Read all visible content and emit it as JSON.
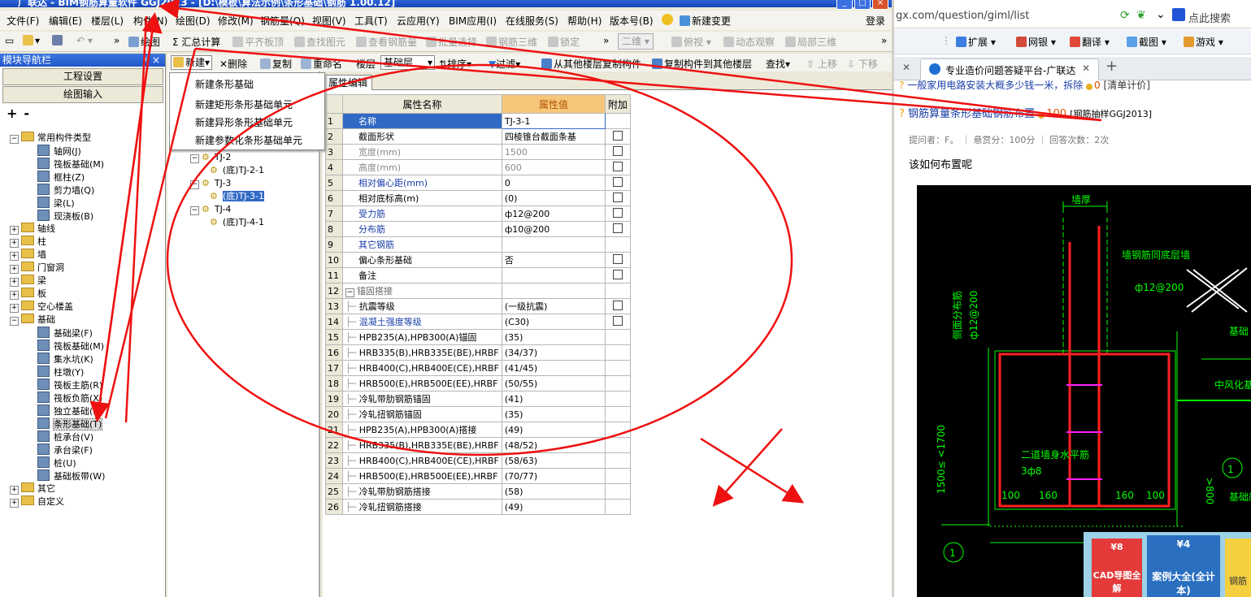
{
  "titlebar": {
    "title": "广联达 - BIM钢筋算量软件 GGJ2013 - [D:\\模板\\算法示例\\条形基础\\钢筋 1.00.12]"
  },
  "menu": [
    "文件(F)",
    "编辑(E)",
    "楼层(L)",
    "构件(N)",
    "绘图(D)",
    "修改(M)",
    "钢筋量(Q)",
    "视图(V)",
    "工具(T)",
    "云应用(Y)",
    "BIM应用(I)",
    "在线服务(S)",
    "帮助(H)",
    "版本号(B)"
  ],
  "menu_extra": {
    "new_change": "新建变更",
    "login": "登录"
  },
  "toolbar1": {
    "draw": "绘图",
    "sum": "汇总计算",
    "flat": "平齐板顶",
    "find": "查找图元",
    "view_rebar": "查看钢筋量",
    "batch": "批量选择",
    "rebar3d": "钢筋三维",
    "lock": "锁定",
    "mode": "二维",
    "top_view": "俯视",
    "dynamic": "动态观察",
    "local3d": "局部三维"
  },
  "nav": {
    "header": "模块导航栏",
    "buttons": [
      "工程设置",
      "绘图输入"
    ],
    "toolbar_icons": [
      "+",
      "-"
    ],
    "tree": [
      {
        "label": "常用构件类型",
        "level": 0,
        "expanded": true
      },
      {
        "label": "轴网(J)",
        "level": 1
      },
      {
        "label": "筏板基础(M)",
        "level": 1
      },
      {
        "label": "框柱(Z)",
        "level": 1
      },
      {
        "label": "剪力墙(Q)",
        "level": 1
      },
      {
        "label": "梁(L)",
        "level": 1
      },
      {
        "label": "现浇板(B)",
        "level": 1
      },
      {
        "label": "轴线",
        "level": 0,
        "expanded": false
      },
      {
        "label": "柱",
        "level": 0,
        "expanded": false
      },
      {
        "label": "墙",
        "level": 0,
        "expanded": false
      },
      {
        "label": "门窗洞",
        "level": 0,
        "expanded": false
      },
      {
        "label": "梁",
        "level": 0,
        "expanded": false
      },
      {
        "label": "板",
        "level": 0,
        "expanded": false
      },
      {
        "label": "空心楼盖",
        "level": 0,
        "expanded": false
      },
      {
        "label": "基础",
        "level": 0,
        "expanded": true
      },
      {
        "label": "基础梁(F)",
        "level": 1
      },
      {
        "label": "筏板基础(M)",
        "level": 1
      },
      {
        "label": "集水坑(K)",
        "level": 1
      },
      {
        "label": "柱墩(Y)",
        "level": 1
      },
      {
        "label": "筏板主筋(R)",
        "level": 1
      },
      {
        "label": "筏板负筋(X)",
        "level": 1
      },
      {
        "label": "独立基础(D)",
        "level": 1
      },
      {
        "label": "条形基础(T)",
        "level": 1,
        "selected": true
      },
      {
        "label": "桩承台(V)",
        "level": 1
      },
      {
        "label": "承台梁(F)",
        "level": 1
      },
      {
        "label": "桩(U)",
        "level": 1
      },
      {
        "label": "基础板带(W)",
        "level": 1
      },
      {
        "label": "其它",
        "level": 0,
        "expanded": false
      },
      {
        "label": "自定义",
        "level": 0,
        "expanded": false
      }
    ]
  },
  "midtool": {
    "new": "新建",
    "delete": "删除",
    "copy": "复制",
    "rename": "重命名",
    "floor_label": "楼层",
    "floor_value": "基础层",
    "sort": "排序",
    "filter": "过滤",
    "copy_from": "从其他楼层复制构件",
    "copy_to": "复制构件到其他楼层",
    "search": "查找",
    "up": "上移",
    "down": "下移"
  },
  "dropdown": [
    "新建条形基础",
    "新建矩形条形基础单元",
    "新建异形条形基础单元",
    "新建参数化条形基础单元"
  ],
  "comp_tree": [
    {
      "label": "TJ-2",
      "level": 0
    },
    {
      "label": "(底)TJ-2-1",
      "level": 1
    },
    {
      "label": "TJ-3",
      "level": 0
    },
    {
      "label": "(底)TJ-3-1",
      "level": 1,
      "selected": true
    },
    {
      "label": "TJ-4",
      "level": 0
    },
    {
      "label": "(底)TJ-4-1",
      "level": 1
    }
  ],
  "prop_tab": "属性编辑",
  "grid": {
    "headers": [
      "属性名称",
      "属性值",
      "附加"
    ],
    "rows": [
      {
        "n": "1",
        "name": "名称",
        "value": "TJ-3-1",
        "chk": false,
        "style": "sel"
      },
      {
        "n": "2",
        "name": "截面形状",
        "value": "四棱锥台截面条基",
        "chk": true
      },
      {
        "n": "3",
        "name": "宽度(mm)",
        "value": "1500",
        "chk": true,
        "style": "grey"
      },
      {
        "n": "4",
        "name": "高度(mm)",
        "value": "600",
        "chk": true,
        "style": "grey"
      },
      {
        "n": "5",
        "name": "相对偏心距(mm)",
        "value": "0",
        "chk": true,
        "style": "blue"
      },
      {
        "n": "6",
        "name": "相对底标高(m)",
        "value": "(0)",
        "chk": true
      },
      {
        "n": "7",
        "name": "受力筋",
        "value": "ф12@200",
        "chk": true,
        "style": "blue"
      },
      {
        "n": "8",
        "name": "分布筋",
        "value": "ф10@200",
        "chk": true,
        "style": "blue"
      },
      {
        "n": "9",
        "name": "其它钢筋",
        "value": "",
        "chk": false,
        "style": "blue"
      },
      {
        "n": "10",
        "name": "偏心条形基础",
        "value": "否",
        "chk": true
      },
      {
        "n": "11",
        "name": "备注",
        "value": "",
        "chk": true
      },
      {
        "n": "12",
        "name": "锚固搭接",
        "value": "",
        "chk": false,
        "style": "group"
      },
      {
        "n": "13",
        "name": "抗震等级",
        "value": "(一级抗震)",
        "chk": true,
        "style": "child"
      },
      {
        "n": "14",
        "name": "混凝土强度等级",
        "value": "(C30)",
        "chk": true,
        "style": "childblue"
      },
      {
        "n": "15",
        "name": "HPB235(A),HPB300(A)锚固",
        "value": "(35)",
        "chk": false,
        "style": "child"
      },
      {
        "n": "16",
        "name": "HRB335(B),HRB335E(BE),HRBF",
        "value": "(34/37)",
        "chk": false,
        "style": "child"
      },
      {
        "n": "17",
        "name": "HRB400(C),HRB400E(CE),HRBF",
        "value": "(41/45)",
        "chk": false,
        "style": "child"
      },
      {
        "n": "18",
        "name": "HRB500(E),HRB500E(EE),HRBF",
        "value": "(50/55)",
        "chk": false,
        "style": "child"
      },
      {
        "n": "19",
        "name": "冷轧带肋钢筋锚固",
        "value": "(41)",
        "chk": false,
        "style": "child"
      },
      {
        "n": "20",
        "name": "冷轧扭钢筋锚固",
        "value": "(35)",
        "chk": false,
        "style": "child"
      },
      {
        "n": "21",
        "name": "HPB235(A),HPB300(A)搭接",
        "value": "(49)",
        "chk": false,
        "style": "child"
      },
      {
        "n": "22",
        "name": "HRB335(B),HRB335E(BE),HRBF",
        "value": "(48/52)",
        "chk": false,
        "style": "child"
      },
      {
        "n": "23",
        "name": "HRB400(C),HRB400E(CE),HRBF",
        "value": "(58/63)",
        "chk": false,
        "style": "child"
      },
      {
        "n": "24",
        "name": "HRB500(E),HRB500E(EE),HRBF",
        "value": "(70/77)",
        "chk": false,
        "style": "child"
      },
      {
        "n": "25",
        "name": "冷轧带肋钢筋搭接",
        "value": "(58)",
        "chk": false,
        "style": "child"
      },
      {
        "n": "26",
        "name": "冷轧扭钢筋搭接",
        "value": "(49)",
        "chk": false,
        "style": "child"
      }
    ]
  },
  "browser": {
    "address": "gx.com/question/giml/list",
    "search_placeholder": "点此搜索",
    "tools": [
      "扩展",
      "网银",
      "翻译",
      "截图",
      "游戏"
    ],
    "tab_title": "专业造价问题答疑平台-广联达",
    "list_item1": "一般家用电路安装大概多少钱一米，拆除",
    "list_item1_score": "0",
    "list_item1_tag": "[清单计价]",
    "question_title": "钢筋算量条形基础钢筋布置",
    "question_score": "100",
    "question_tag": "[钢筋抽样GGJ2013]",
    "meta": "提问者：F。 ｜ 悬赏分：100分 ｜ 回答次数：2次",
    "body": "该如何布置呢"
  },
  "cad": {
    "labels": [
      "墙厚",
      "墙钢筋同底层墙",
      "ф12@200",
      "基础",
      "中风化基",
      "基础底",
      "1500≤ <1700",
      "二道墙身水平筋",
      "3ф8",
      "100",
      "160",
      "160",
      "100",
      ">800",
      "1",
      "基础底",
      "1",
      "侧面分布筋",
      "ф12@200"
    ]
  },
  "ad": {
    "a": "CAD导图全解",
    "b": "案例大全(全计本)",
    "badge1": "¥8",
    "badge2": "¥4",
    "c": "钢筋"
  }
}
